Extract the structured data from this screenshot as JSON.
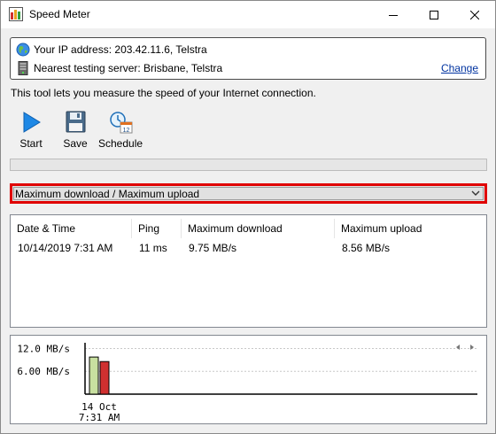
{
  "window": {
    "title": "Speed Meter",
    "app_icon": "speedmeter-app-icon",
    "controls": [
      "minimize-icon",
      "maximize-icon",
      "close-icon"
    ]
  },
  "info": {
    "ip_label": "Your IP address: 203.42.11.6, Telstra",
    "server_label": "Nearest testing server: Brisbane, Telstra",
    "change_link": "Change",
    "ip_icon": "globe-icon",
    "server_icon": "server-icon"
  },
  "description": "This tool lets you measure the speed of your Internet connection.",
  "toolbar": {
    "start": "Start",
    "save": "Save",
    "schedule": "Schedule",
    "schedule_icon_number": "12"
  },
  "progress": {
    "value": 0
  },
  "mode_select": {
    "selected": "Maximum download / Maximum upload"
  },
  "table": {
    "headers": [
      "Date & Time",
      "Ping",
      "Maximum download",
      "Maximum upload"
    ],
    "rows": [
      [
        "10/14/2019 7:31 AM",
        "11 ms",
        "9.75 MB/s",
        "8.56 MB/s"
      ]
    ]
  },
  "chart_data": {
    "type": "bar",
    "categories": [
      "14 Oct 7:31 AM"
    ],
    "category_line1": "14 Oct",
    "category_line2": "7:31 AM",
    "series": [
      {
        "values": [
          9.75
        ],
        "color": "#c8e0a0"
      },
      {
        "values": [
          8.56
        ],
        "color": "#d03030"
      }
    ],
    "ytick_labels": [
      "12.0 MB/s",
      "6.00 MB/s"
    ],
    "yticks": [
      12,
      6
    ],
    "ylim": [
      0,
      13.5
    ],
    "grid": true
  }
}
